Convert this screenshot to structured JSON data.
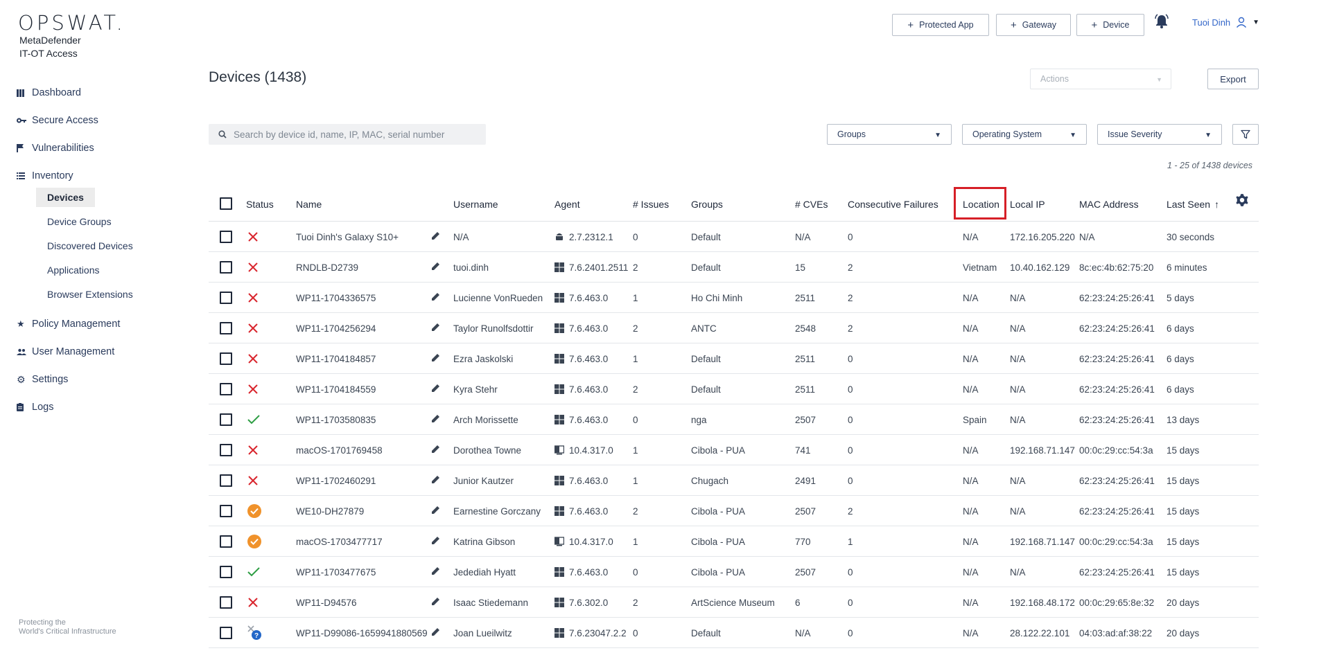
{
  "brand": {
    "logo": "OPSWAT.",
    "product_line1": "MetaDefender",
    "product_line2": "IT-OT Access",
    "footer_line1": "Protecting the",
    "footer_line2": "World's Critical Infrastructure"
  },
  "nav": {
    "dashboard": "Dashboard",
    "secure_access": "Secure Access",
    "vulnerabilities": "Vulnerabilities",
    "inventory": "Inventory",
    "inventory_sub": [
      "Devices",
      "Device Groups",
      "Discovered Devices",
      "Applications",
      "Browser Extensions"
    ],
    "policy_management": "Policy Management",
    "user_management": "User Management",
    "settings": "Settings",
    "logs": "Logs"
  },
  "header": {
    "protected_app": "Protected App",
    "gateway": "Gateway",
    "device": "Device",
    "user_name": "Tuoi Dinh"
  },
  "page": {
    "title": "Devices (1438)",
    "actions_placeholder": "Actions",
    "export_label": "Export"
  },
  "filters": {
    "search_placeholder": "Search by device id, name, IP, MAC, serial number",
    "groups": "Groups",
    "operating_system": "Operating System",
    "issue_severity": "Issue Severity"
  },
  "pagination": {
    "range": "1 - 25",
    "of_label": "of",
    "total": "1438",
    "unit": "devices"
  },
  "columns": {
    "status": "Status",
    "name": "Name",
    "username": "Username",
    "agent": "Agent",
    "issues": "# Issues",
    "groups": "Groups",
    "cves": "# CVEs",
    "consecutive_failures": "Consecutive Failures",
    "location": "Location",
    "local_ip": "Local IP",
    "mac_address": "MAC Address",
    "last_seen": "Last Seen",
    "sort_arrow": "↑"
  },
  "status_colors": {
    "fail": "#d9262e",
    "ok": "#2e9e44",
    "warn": "#f0922b",
    "unknown": "#2367c8"
  },
  "rows": [
    {
      "status": "fail",
      "name": "Tuoi Dinh's Galaxy S10+",
      "username": "N/A",
      "os": "android",
      "agent": "2.7.2312.1",
      "issues": "0",
      "groups": "Default",
      "cves": "N/A",
      "failures": "0",
      "location": "N/A",
      "local_ip": "172.16.205.220",
      "mac": "N/A",
      "last_seen": "30 seconds"
    },
    {
      "status": "fail",
      "name": "RNDLB-D2739",
      "username": "tuoi.dinh",
      "os": "windows",
      "agent": "7.6.2401.2511",
      "issues": "2",
      "groups": "Default",
      "cves": "15",
      "failures": "2",
      "location": "Vietnam",
      "local_ip": "10.40.162.129",
      "mac": "8c:ec:4b:62:75:20",
      "last_seen": "6 minutes"
    },
    {
      "status": "fail",
      "name": "WP11-1704336575",
      "username": "Lucienne VonRueden",
      "os": "windows",
      "agent": "7.6.463.0",
      "issues": "1",
      "groups": "Ho Chi Minh",
      "cves": "2511",
      "failures": "2",
      "location": "N/A",
      "local_ip": "N/A",
      "mac": "62:23:24:25:26:41",
      "last_seen": "5 days"
    },
    {
      "status": "fail",
      "name": "WP11-1704256294",
      "username": "Taylor Runolfsdottir",
      "os": "windows",
      "agent": "7.6.463.0",
      "issues": "2",
      "groups": "ANTC",
      "cves": "2548",
      "failures": "2",
      "location": "N/A",
      "local_ip": "N/A",
      "mac": "62:23:24:25:26:41",
      "last_seen": "6 days"
    },
    {
      "status": "fail",
      "name": "WP11-1704184857",
      "username": "Ezra Jaskolski",
      "os": "windows",
      "agent": "7.6.463.0",
      "issues": "1",
      "groups": "Default",
      "cves": "2511",
      "failures": "0",
      "location": "N/A",
      "local_ip": "N/A",
      "mac": "62:23:24:25:26:41",
      "last_seen": "6 days"
    },
    {
      "status": "fail",
      "name": "WP11-1704184559",
      "username": "Kyra Stehr",
      "os": "windows",
      "agent": "7.6.463.0",
      "issues": "2",
      "groups": "Default",
      "cves": "2511",
      "failures": "0",
      "location": "N/A",
      "local_ip": "N/A",
      "mac": "62:23:24:25:26:41",
      "last_seen": "6 days"
    },
    {
      "status": "ok",
      "name": "WP11-1703580835",
      "username": "Arch Morissette",
      "os": "windows",
      "agent": "7.6.463.0",
      "issues": "0",
      "groups": "nga",
      "cves": "2507",
      "failures": "0",
      "location": "Spain",
      "local_ip": "N/A",
      "mac": "62:23:24:25:26:41",
      "last_seen": "13 days"
    },
    {
      "status": "fail",
      "name": "macOS-1701769458",
      "username": "Dorothea Towne",
      "os": "mac",
      "agent": "10.4.317.0",
      "issues": "1",
      "groups": "Cibola - PUA",
      "cves": "741",
      "failures": "0",
      "location": "N/A",
      "local_ip": "192.168.71.147",
      "mac": "00:0c:29:cc:54:3a",
      "last_seen": "15 days"
    },
    {
      "status": "fail",
      "name": "WP11-1702460291",
      "username": "Junior Kautzer",
      "os": "windows",
      "agent": "7.6.463.0",
      "issues": "1",
      "groups": "Chugach",
      "cves": "2491",
      "failures": "0",
      "location": "N/A",
      "local_ip": "N/A",
      "mac": "62:23:24:25:26:41",
      "last_seen": "15 days"
    },
    {
      "status": "warn",
      "name": "WE10-DH27879",
      "username": "Earnestine Gorczany",
      "os": "windows",
      "agent": "7.6.463.0",
      "issues": "2",
      "groups": "Cibola - PUA",
      "cves": "2507",
      "failures": "2",
      "location": "N/A",
      "local_ip": "N/A",
      "mac": "62:23:24:25:26:41",
      "last_seen": "15 days"
    },
    {
      "status": "warn",
      "name": "macOS-1703477717",
      "username": "Katrina Gibson",
      "os": "mac",
      "agent": "10.4.317.0",
      "issues": "1",
      "groups": "Cibola - PUA",
      "cves": "770",
      "failures": "1",
      "location": "N/A",
      "local_ip": "192.168.71.147",
      "mac": "00:0c:29:cc:54:3a",
      "last_seen": "15 days"
    },
    {
      "status": "ok",
      "name": "WP11-1703477675",
      "username": "Jedediah Hyatt",
      "os": "windows",
      "agent": "7.6.463.0",
      "issues": "0",
      "groups": "Cibola - PUA",
      "cves": "2507",
      "failures": "0",
      "location": "N/A",
      "local_ip": "N/A",
      "mac": "62:23:24:25:26:41",
      "last_seen": "15 days"
    },
    {
      "status": "fail",
      "name": "WP11-D94576",
      "username": "Isaac Stiedemann",
      "os": "windows",
      "agent": "7.6.302.0",
      "issues": "2",
      "groups": "ArtScience Museum",
      "cves": "6",
      "failures": "0",
      "location": "N/A",
      "local_ip": "192.168.48.172",
      "mac": "00:0c:29:65:8e:32",
      "last_seen": "20 days"
    },
    {
      "status": "unknown",
      "name": "WP11-D99086-1659941880569",
      "username": "Joan Lueilwitz",
      "os": "windows",
      "agent": "7.6.23047.2.2",
      "issues": "0",
      "groups": "Default",
      "cves": "N/A",
      "failures": "0",
      "location": "N/A",
      "local_ip": "28.122.22.101",
      "mac": "04:03:ad:af:38:22",
      "last_seen": "20 days"
    }
  ]
}
